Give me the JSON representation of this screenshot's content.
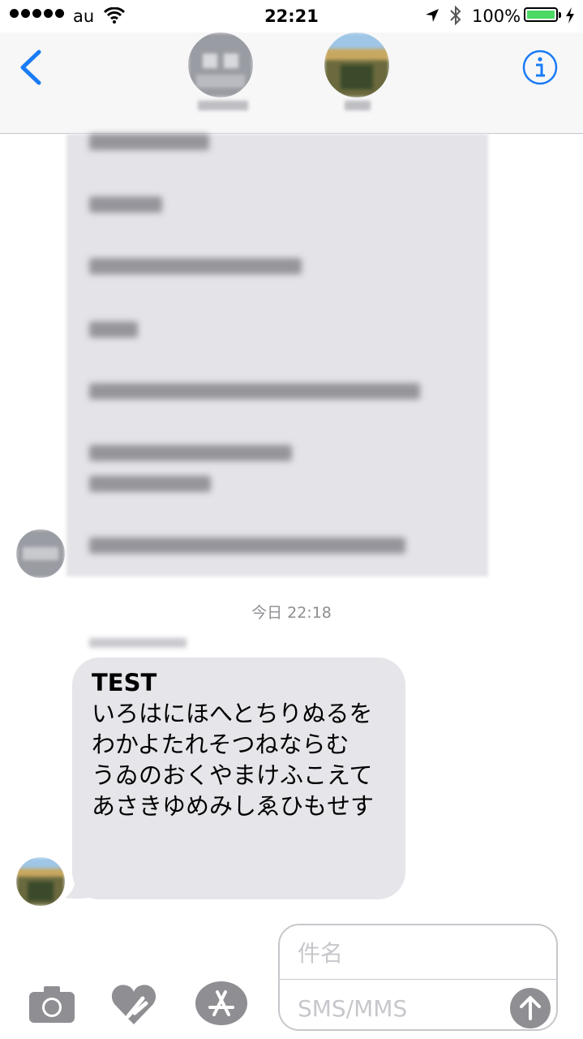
{
  "status_bar": {
    "carrier": "au",
    "time": "22:21",
    "battery_percent": "100%",
    "battery_level": 1.0,
    "icons": [
      "signal-dots-icon",
      "wifi-icon",
      "location-arrow-icon",
      "bluetooth-icon",
      "battery-icon",
      "charging-bolt-icon"
    ]
  },
  "header": {
    "back_icon": "chevron-left-icon",
    "info_icon": "info-icon",
    "accent_color": "#1a7cf5"
  },
  "thread": {
    "timestamp": "今日 22:18",
    "message": {
      "title": "TEST",
      "lines": [
        "いろはにほへとちりぬるを",
        "わかよたれそつねならむ",
        "うゐのおくやまけふこえて",
        "あさきゆめみしゑひもせす"
      ],
      "bubble_color": "#e5e5ea"
    }
  },
  "composer": {
    "subject_placeholder": "件名",
    "body_placeholder": "SMS/MMS",
    "icons": [
      "camera-icon",
      "digital-touch-icon",
      "app-store-icon",
      "send-arrow-icon"
    ]
  }
}
